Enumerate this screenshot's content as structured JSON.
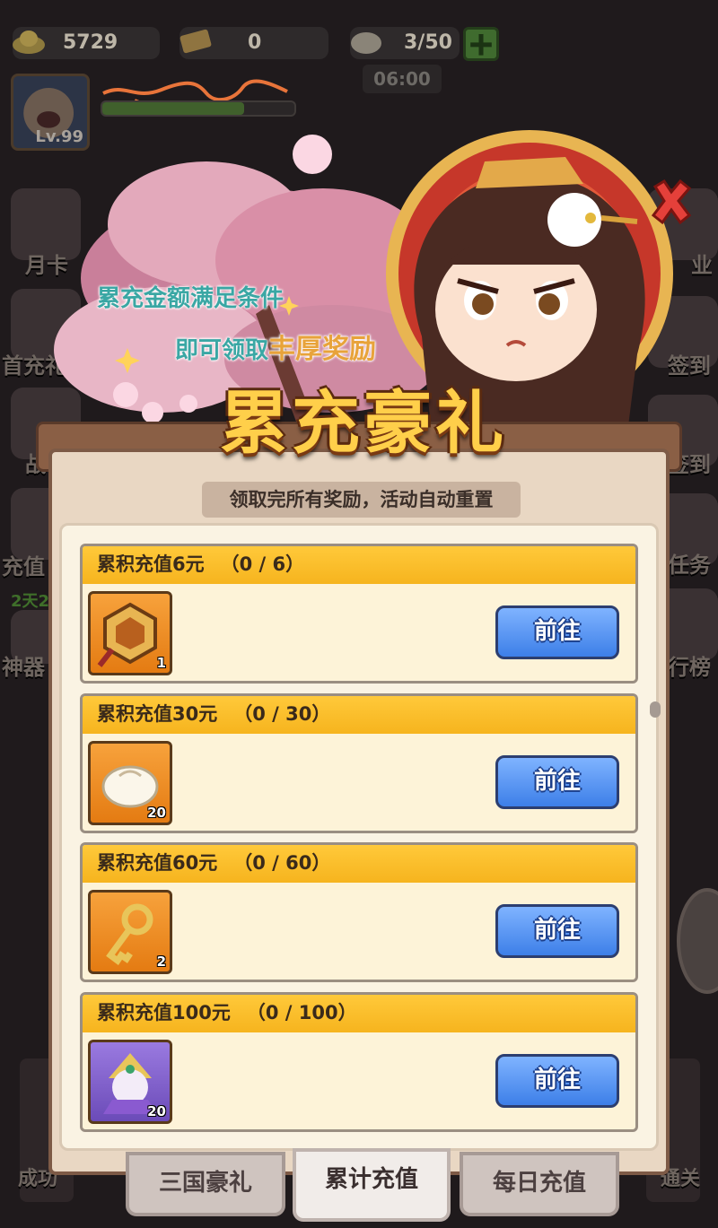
{
  "hud": {
    "gold": "5729",
    "tickets": "0",
    "stamina": "3/50",
    "timer": "06:00",
    "level": "Lv.99"
  },
  "side_left": [
    "月卡",
    "首充礼包",
    "战",
    "充值",
    "神器"
  ],
  "side_left_timer": "2天2",
  "side_right": [
    "业",
    "签到",
    "签到",
    "任务",
    "行榜"
  ],
  "bottom_left": "成功",
  "bottom_right": "通关",
  "banner": {
    "line1": "累充金额满足条件",
    "line2_prefix": "即可领取",
    "line2_highlight": "丰厚奖励"
  },
  "popup": {
    "title": "累充豪礼",
    "subtitle": "领取完所有奖励，活动自动重置"
  },
  "tiers": [
    {
      "label": "累积充值6元",
      "progress": "（0 / 6）",
      "reward_icon": "token-icon",
      "count": "1",
      "button": "前往"
    },
    {
      "label": "累积充值30元",
      "progress": "（0 / 30）",
      "reward_icon": "bun-icon",
      "count": "20",
      "button": "前往"
    },
    {
      "label": "累积充值60元",
      "progress": "（0 / 60）",
      "reward_icon": "key-icon",
      "count": "2",
      "button": "前往"
    },
    {
      "label": "累积充值100元",
      "progress": "（0 / 100）",
      "reward_icon": "hero-portrait-icon",
      "count": "20",
      "button": "前往"
    }
  ],
  "tabs": [
    {
      "label": "三国豪礼",
      "active": false
    },
    {
      "label": "累计充值",
      "active": true
    },
    {
      "label": "每日充值",
      "active": false
    }
  ],
  "colors": {
    "accent_gold": "#ffcf4a",
    "button_blue": "#3d7fe8",
    "row_header": "#f6b41e"
  }
}
